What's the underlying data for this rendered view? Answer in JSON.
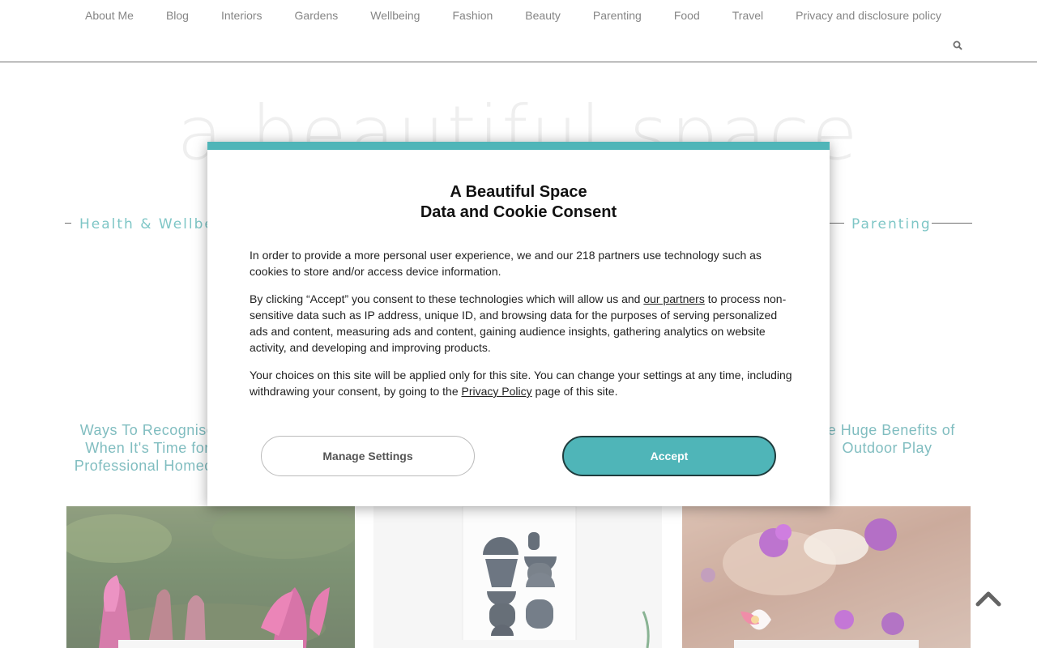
{
  "nav": {
    "items": [
      "About Me",
      "Blog",
      "Interiors",
      "Gardens",
      "Wellbeing",
      "Fashion",
      "Beauty",
      "Parenting",
      "Food",
      "Travel",
      "Privacy and disclosure policy"
    ],
    "search_icon": "search-icon"
  },
  "logo": {
    "text": "a beautiful space"
  },
  "categories": {
    "left": "Health & Wellbein",
    "right": "Parenting"
  },
  "posts": {
    "left_title": "Ways To Recognise When It's Time for Professional Homeca",
    "right_title": "he Huge Benefits of Outdoor Play"
  },
  "modal": {
    "title_line1": "A Beautiful Space",
    "title_line2": "Data and Cookie Consent",
    "para1": "In order to provide a more personal user experience, we and our 218 partners use technology such as cookies to store and/or access device information.",
    "para2_pre": "By clicking “Accept” you consent to these technologies which will allow us and ",
    "para2_link": "our partners",
    "para2_post": " to process non-sensitive data such as IP address, unique ID, and browsing data for the purposes of serving personalized ads and content, measuring ads and content, gaining audience insights, gathering analytics on website activity, and developing and improving products.",
    "para3_pre": "Your choices on this site will be applied only for this site. You can change your settings at any time, including withdrawing your consent, by going to the ",
    "para3_link": "Privacy Policy",
    "para3_post": " page of this site.",
    "manage_label": "Manage Settings",
    "accept_label": "Accept"
  },
  "colors": {
    "accent": "#4fb5b8",
    "link": "#3d9a9e"
  },
  "scroll_top_icon": "chevron-up-icon"
}
